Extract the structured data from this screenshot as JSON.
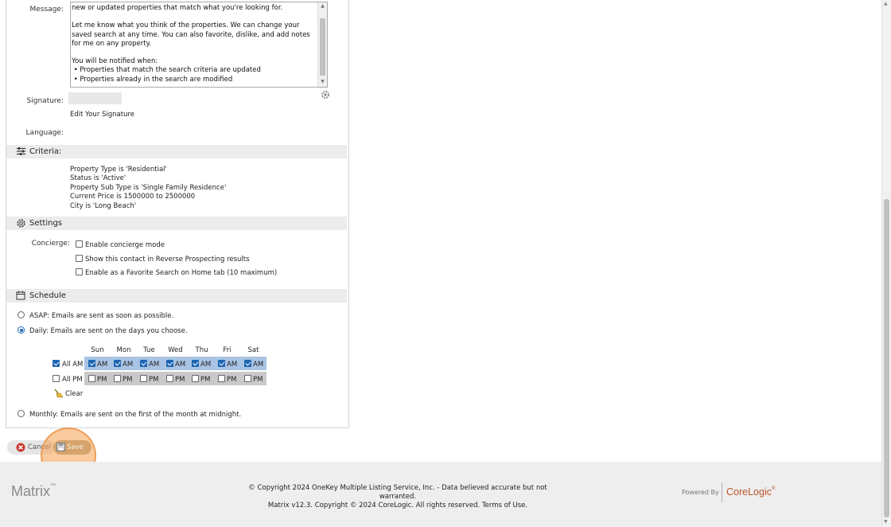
{
  "message": {
    "label": "Message:",
    "text": "new or updated properties that match what you're looking for.\n\nLet me know what you think of the properties. We can change your saved search at any time. You can also favorite, dislike, and add notes for me on any property.\n\nYou will be notified when:\n • Properties that match the search criteria are updated\n • Properties already in the search are modified"
  },
  "signature": {
    "label": "Signature:",
    "edit_link": "Edit Your Signature"
  },
  "language": {
    "label": "Language:"
  },
  "criteria": {
    "title": "Criteria:",
    "lines": [
      "Property Type is 'Residential'",
      "Status is 'Active'",
      "Property Sub Type is 'Single Family Residence'",
      "Current Price is 1500000 to 2500000",
      "City is 'Long Beach'"
    ]
  },
  "settings": {
    "title": "Settings",
    "concierge_label": "Concierge:",
    "options": [
      {
        "label": "Enable concierge mode",
        "checked": false
      },
      {
        "label": "Show this contact in Reverse Prospecting results",
        "checked": false
      },
      {
        "label": "Enable as a Favorite Search on Home tab (10 maximum)",
        "checked": false
      }
    ]
  },
  "schedule": {
    "title": "Schedule",
    "asap": "ASAP: Emails are sent as soon as possible.",
    "daily": "Daily: Emails are sent on the days you choose.",
    "monthly": "Monthly: Emails are sent on the first of the month at midnight.",
    "selected": "daily",
    "days": [
      "Sun",
      "Mon",
      "Tue",
      "Wed",
      "Thu",
      "Fri",
      "Sat"
    ],
    "all_am": "All AM",
    "all_pm": "All PM",
    "am": "AM",
    "pm": "PM",
    "am_checked": true,
    "pm_checked": false,
    "clear": "Clear"
  },
  "buttons": {
    "cancel": "Cancel",
    "save": "Save"
  },
  "footer": {
    "logo": "Matrix",
    "tm": "™",
    "copyright1": "© Copyright 2024 OneKey Multiple Listing Service, Inc. - Data believed accurate but not warranted.",
    "copyright2": "Matrix v12.3. Copyright © 2024 CoreLogic. All rights reserved.",
    "terms": "Terms of Use.",
    "powered_by": "Powered By",
    "brand": "CoreLogic",
    "brand_mark": "®"
  },
  "colors": {
    "accent": "#1e66b3",
    "link": "#1d5c8c",
    "save_highlight": "#f5a050",
    "brand": "#c0542b"
  }
}
